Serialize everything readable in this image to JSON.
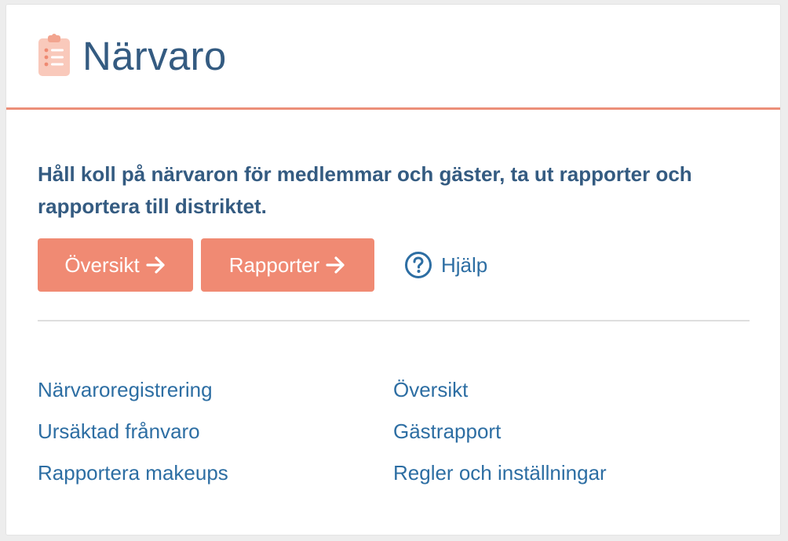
{
  "header": {
    "title": "Närvaro",
    "icon": "clipboard-list-icon"
  },
  "description": "Håll koll på närvaron för medlemmar och gäster, ta ut rapporter och rapportera till distriktet.",
  "actions": {
    "overview_label": "Översikt",
    "reports_label": "Rapporter",
    "help_label": "Hjälp",
    "arrow_icon": "arrow-right-icon",
    "help_icon": "question-circle-icon"
  },
  "links": {
    "left": [
      {
        "label": "Närvaroregistrering"
      },
      {
        "label": "Ursäktad frånvaro"
      },
      {
        "label": "Rapportera makeups"
      }
    ],
    "right": [
      {
        "label": "Översikt"
      },
      {
        "label": "Gästrapport"
      },
      {
        "label": "Regler och inställningar"
      }
    ]
  },
  "colors": {
    "accent": "#f08a73",
    "title": "#345b81",
    "link": "#2d6ea3",
    "divider": "#dedede"
  }
}
